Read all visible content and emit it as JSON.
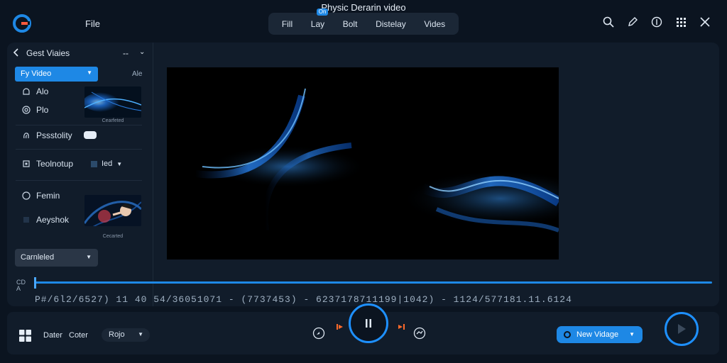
{
  "app": {
    "title": "Physic Derarin video",
    "menu_file": "File"
  },
  "tabs": [
    {
      "label": "Fill"
    },
    {
      "label": "Lay",
      "badge": "On"
    },
    {
      "label": "Bolt"
    },
    {
      "label": "Distelay"
    },
    {
      "label": "Vides"
    }
  ],
  "top_icons": [
    "search-icon",
    "pen-icon",
    "info-icon",
    "grid-icon",
    "close-icon"
  ],
  "sidebar": {
    "header": {
      "back_icon": "chevron-left-icon",
      "title": "Gest Viaies",
      "dash": "--"
    },
    "select": {
      "value": "Fy Video"
    },
    "alt_label": "Ale",
    "items": [
      {
        "label": "Alo",
        "icon": "bell-icon"
      },
      {
        "label": "Plo",
        "icon": "target-icon"
      },
      {
        "label": "Pssstolity",
        "icon": "fingerprint-icon"
      },
      {
        "label": "Teolnotup",
        "icon": "chip-icon"
      },
      {
        "label": "Femin",
        "icon": "circle-icon"
      },
      {
        "label": "Aeyshok",
        "icon": "square-icon"
      }
    ],
    "thumb_caption_1": "Cearfeted",
    "thumb_caption_2": "Cecarted",
    "tech_value": "Ied",
    "bottom_select": "Carnleled"
  },
  "timeline": {
    "label": "CD A",
    "timecode": "P#/6l2/6527) 11 40 54/36051071 - (7737453) - 6237178711199|1042) - 1124/577181.11.6124",
    "progress": 0.0
  },
  "bottom": {
    "date_label": "Dater",
    "color_label": "Coter",
    "select_value": "Rojo",
    "new_button": "New Vidage",
    "pause_icon": "pause-icon",
    "play_icon": "play-icon"
  },
  "colors": {
    "accent": "#1e88e5",
    "background": "#0b1420",
    "panel": "#111c2a"
  }
}
